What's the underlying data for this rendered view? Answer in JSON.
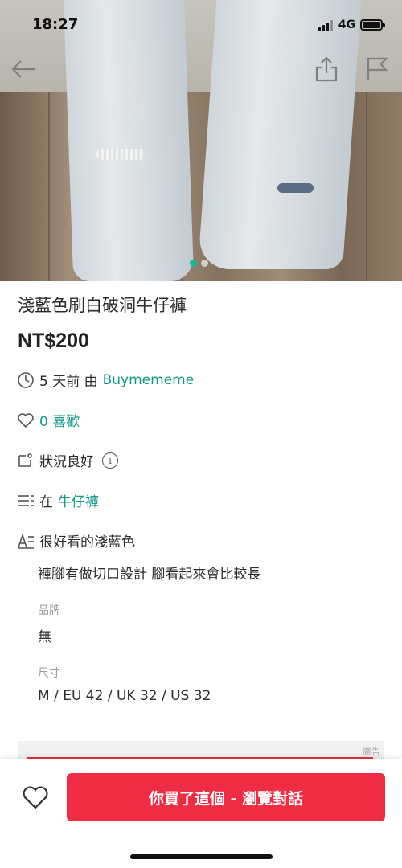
{
  "status_bar": {
    "time": "18:27",
    "network": "4G"
  },
  "icons": {
    "back": "arrow-left-icon",
    "share": "share-icon",
    "report": "flag-icon"
  },
  "carousel": {
    "active_color": "#20b49c",
    "inactive_color": "#d0d0d0",
    "count": 2,
    "active_index": 0
  },
  "listing": {
    "title": "淺藍色刷白破洞牛仔褲",
    "price": "NT$200",
    "posted_ago": "5 天前 由",
    "seller": "Buymememe",
    "likes": "0 喜歡",
    "condition": "狀況良好",
    "category_prefix": "在",
    "category": "牛仔褲",
    "description_line1": "很好看的淺藍色",
    "description_line2": "褲腳有做切口設計 腳看起來會比較長",
    "brand_label": "品牌",
    "brand_value": "無",
    "size_label": "尺寸",
    "size_value": "M / EU 42 / UK 32 / US 32"
  },
  "ad": {
    "label": "廣告"
  },
  "bottom_bar": {
    "cta_label": "你買了這個 - 瀏覽對話",
    "cta_color": "#ee2d44"
  },
  "colors": {
    "link": "#119a88"
  }
}
